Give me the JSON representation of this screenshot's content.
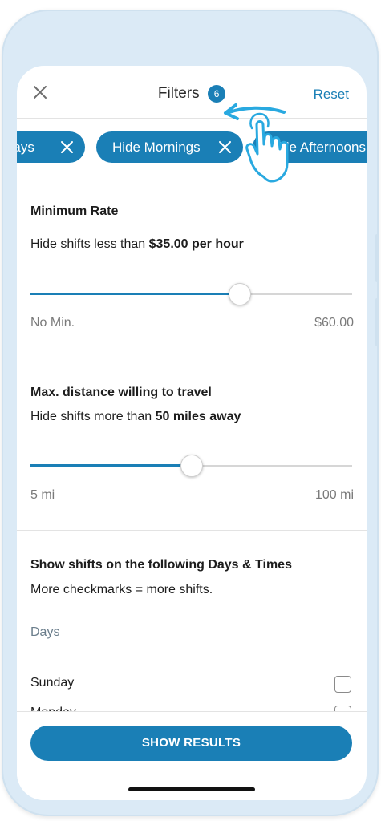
{
  "header": {
    "title": "Filters",
    "filter_count": "6",
    "reset_label": "Reset"
  },
  "chips": [
    {
      "label": "Hide Sundays"
    },
    {
      "label": "Hide Mornings"
    },
    {
      "label": "Hide Afternoons"
    }
  ],
  "minimum_rate": {
    "title": "Minimum Rate",
    "subtitle_prefix": "Hide shifts less than ",
    "subtitle_value": "$35.00 per hour",
    "slider_fraction": 0.65,
    "min_label": "No Min.",
    "max_label": "$60.00"
  },
  "distance": {
    "title": "Max. distance willing to travel",
    "subtitle_prefix": "Hide shifts more than ",
    "subtitle_value": "50 miles away",
    "slider_fraction": 0.5,
    "min_label": "5 mi",
    "max_label": "100 mi"
  },
  "days_times": {
    "title": "Show shifts on the following Days & Times",
    "subtitle": "More checkmarks = more shifts.",
    "days_label": "Days",
    "days": [
      {
        "name": "Sunday",
        "checked": false
      },
      {
        "name": "Monday",
        "checked": false
      }
    ]
  },
  "footer": {
    "show_results_label": "SHOW RESULTS"
  },
  "colors": {
    "accent": "#1a7fb6",
    "frame": "#dbeaf6"
  },
  "icons": {
    "close": "close-icon",
    "chip_remove": "x-icon",
    "gesture": "swipe-left-hand-icon"
  }
}
